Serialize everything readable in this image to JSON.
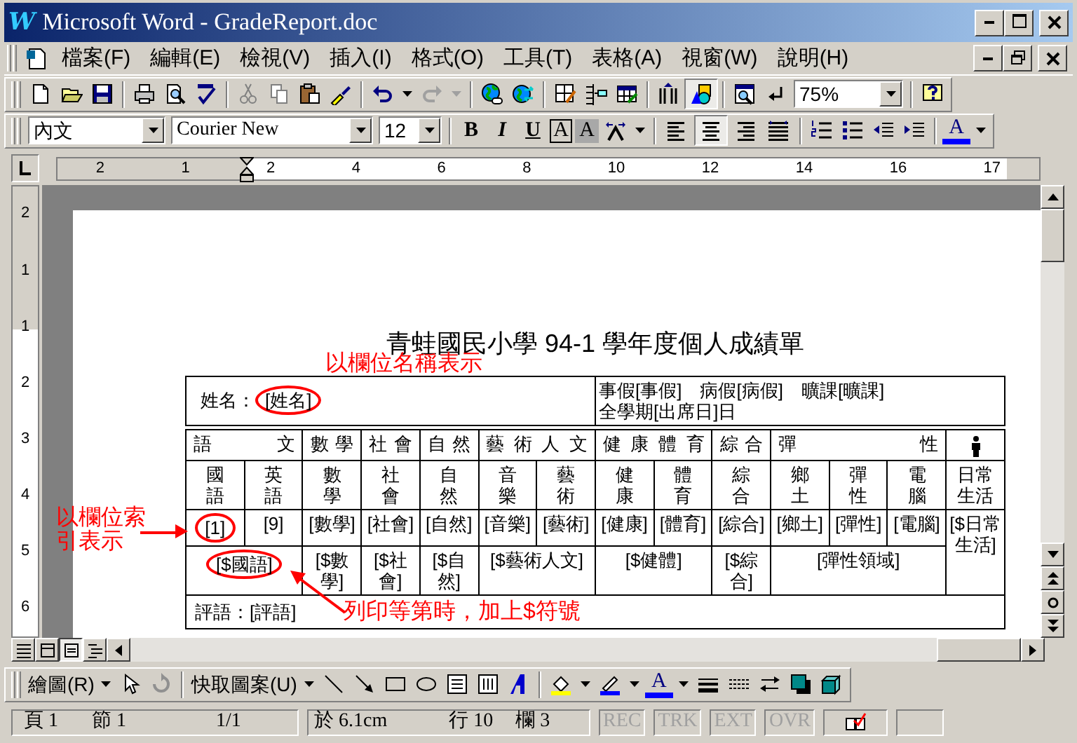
{
  "window": {
    "logo": "W",
    "title": "Microsoft Word - GradeReport.doc"
  },
  "menu": [
    {
      "label": "檔案(F)"
    },
    {
      "label": "編輯(E)"
    },
    {
      "label": "檢視(V)"
    },
    {
      "label": "插入(I)"
    },
    {
      "label": "格式(O)"
    },
    {
      "label": "工具(T)"
    },
    {
      "label": "表格(A)"
    },
    {
      "label": "視窗(W)"
    },
    {
      "label": "說明(H)"
    }
  ],
  "standard_toolbar": {
    "drawing_on": true,
    "zoom": "75%"
  },
  "formatting_toolbar": {
    "style": "內文",
    "font": "Courier New",
    "size": "12",
    "bold": "B",
    "italic": "I",
    "underline": "U",
    "border_letter": "A",
    "shading_letter": "A",
    "align_buttons": [
      {
        "selected": false
      },
      {
        "selected": true
      },
      {
        "selected": false
      },
      {
        "selected": false
      }
    ],
    "font_color_letter": "A"
  },
  "ruler": {
    "labels": [
      "2",
      "1",
      "2",
      "4",
      "6",
      "8",
      "10",
      "12",
      "14",
      "16",
      "17"
    ]
  },
  "vertical_ruler": {
    "labels": [
      "2",
      "1",
      "1",
      "2",
      "3",
      "4",
      "5",
      "6"
    ]
  },
  "document": {
    "title": "青蛙國民小學 94-1 學年度個人成績單",
    "name_cell": {
      "label": "姓名：",
      "field": "[姓名]",
      "circled": true
    },
    "attendance": "事假[事假]　病假[病假]　曠課[曠課]",
    "term_days": "全學期[出席日]日",
    "groups": [
      {
        "kind": "text",
        "header": "語文",
        "grade": "[$國語]",
        "grade_circled": true,
        "subjects": [
          {
            "name": "國語",
            "field": "[1]",
            "circled": true
          },
          {
            "name": "英語",
            "field": "[9]",
            "circled": false
          }
        ]
      },
      {
        "kind": "text",
        "header": "數學",
        "grade": "[$數學]",
        "grade_circled": false,
        "subjects": [
          {
            "name": "數學",
            "field": "[數學]",
            "circled": false
          }
        ]
      },
      {
        "kind": "text",
        "header": "社會",
        "grade": "[$社會]",
        "grade_circled": false,
        "subjects": [
          {
            "name": "社會",
            "field": "[社會]",
            "circled": false
          }
        ]
      },
      {
        "kind": "text",
        "header": "自然",
        "grade": "[$自然]",
        "grade_circled": false,
        "subjects": [
          {
            "name": "自然",
            "field": "[自然]",
            "circled": false
          }
        ]
      },
      {
        "kind": "text",
        "header": "藝術人文",
        "grade": "[$藝術人文]",
        "grade_circled": false,
        "subjects": [
          {
            "name": "音樂",
            "field": "[音樂]",
            "circled": false
          },
          {
            "name": "藝術",
            "field": "[藝術]",
            "circled": false
          }
        ]
      },
      {
        "kind": "text",
        "header": "健康體育",
        "grade": "[$健體]",
        "grade_circled": false,
        "subjects": [
          {
            "name": "健康",
            "field": "[健康]",
            "circled": false
          },
          {
            "name": "體育",
            "field": "[體育]",
            "circled": false
          }
        ]
      },
      {
        "kind": "text",
        "header": "綜合",
        "grade": "[$綜合]",
        "grade_circled": false,
        "subjects": [
          {
            "name": "綜合",
            "field": "[綜合]",
            "circled": false
          }
        ]
      },
      {
        "kind": "text",
        "header": "彈性",
        "grade": "[彈性領域]",
        "grade_circled": false,
        "subjects": [
          {
            "name": "鄉土",
            "field": "[鄉土]",
            "circled": false
          },
          {
            "name": "彈性",
            "field": "[彈性]",
            "circled": false
          },
          {
            "name": "電腦",
            "field": "[電腦]",
            "circled": false
          }
        ]
      },
      {
        "kind": "icon",
        "subjects": [
          {
            "name": "日常生活",
            "field": "[$日常生活]",
            "circled": false
          }
        ]
      }
    ],
    "comment": "評語：[評語]",
    "notes": [
      {
        "text": "以欄位名稱表示"
      },
      {
        "text": "以欄位索引表示"
      },
      {
        "text": "列印等第時，加上$符號"
      }
    ]
  },
  "view_buttons": [
    {
      "selected": false
    },
    {
      "selected": false
    },
    {
      "selected": true
    },
    {
      "selected": false
    }
  ],
  "drawing_toolbar": {
    "draw_menu": "繪圖(R)",
    "autoshapes_menu": "快取圖案(U)",
    "font_color_letter": "A"
  },
  "status_bar": {
    "page": "頁 1",
    "section": "節 1",
    "pages": "1/1",
    "at": "於 6.1cm",
    "line": "行 10",
    "column": "欄 3",
    "modes": [
      {
        "label": "REC",
        "disabled": true
      },
      {
        "label": "TRK",
        "disabled": true
      },
      {
        "label": "EXT",
        "disabled": true
      },
      {
        "label": "OVR",
        "disabled": true
      }
    ]
  }
}
